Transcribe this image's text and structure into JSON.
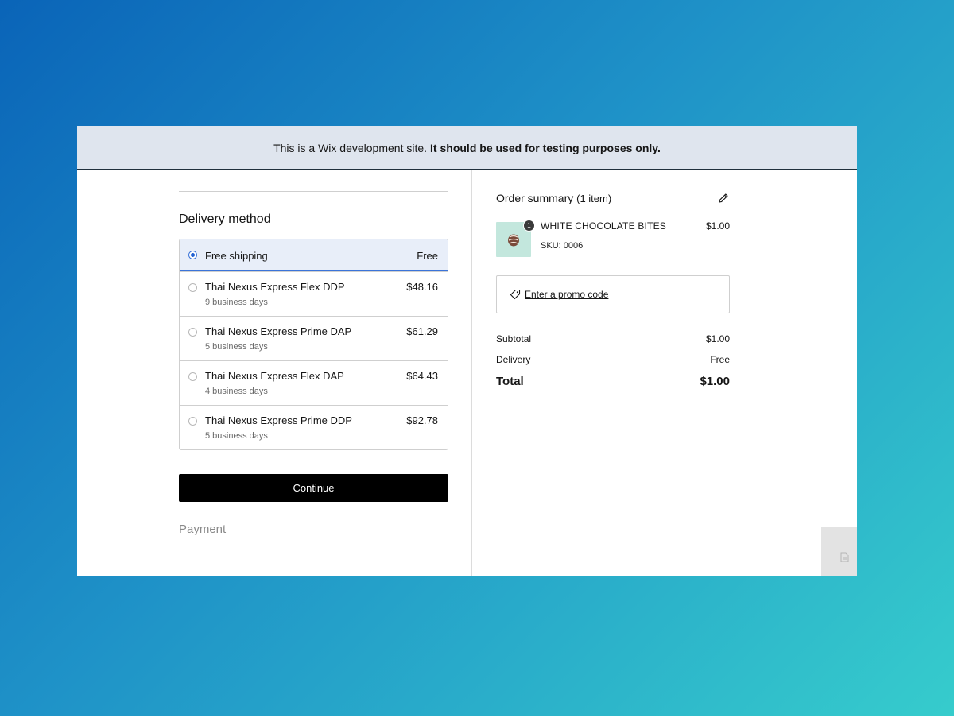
{
  "banner": {
    "text_regular": "This is a Wix development site.",
    "text_bold": "It should be used for testing purposes only."
  },
  "delivery": {
    "title": "Delivery method",
    "options": [
      {
        "name": "Free shipping",
        "subtitle": "",
        "price": "Free",
        "selected": true
      },
      {
        "name": "Thai Nexus Express Flex DDP",
        "subtitle": "9 business days",
        "price": "$48.16",
        "selected": false
      },
      {
        "name": "Thai Nexus Express Prime DAP",
        "subtitle": "5 business days",
        "price": "$61.29",
        "selected": false
      },
      {
        "name": "Thai Nexus Express Flex DAP",
        "subtitle": "4 business days",
        "price": "$64.43",
        "selected": false
      },
      {
        "name": "Thai Nexus Express Prime DDP",
        "subtitle": "5 business days",
        "price": "$92.78",
        "selected": false
      }
    ],
    "continue_label": "Continue",
    "next_section_label": "Payment"
  },
  "summary": {
    "title": "Order summary",
    "item_count": "(1 item)",
    "item": {
      "name": "WHITE CHOCOLATE BITES",
      "price": "$1.00",
      "sku": "SKU: 0006",
      "quantity": "1"
    },
    "promo_label": "Enter a promo code",
    "rows": {
      "subtotal_label": "Subtotal",
      "subtotal_value": "$1.00",
      "delivery_label": "Delivery",
      "delivery_value": "Free",
      "total_label": "Total",
      "total_value": "$1.00"
    }
  },
  "colors": {
    "accent": "#3b74d9",
    "banner_bg": "#dfe5ee",
    "button_bg": "#000000",
    "thumb_bg": "#c3e7dd"
  },
  "icons": [
    "pencil-icon",
    "tag-icon",
    "document-icon"
  ]
}
